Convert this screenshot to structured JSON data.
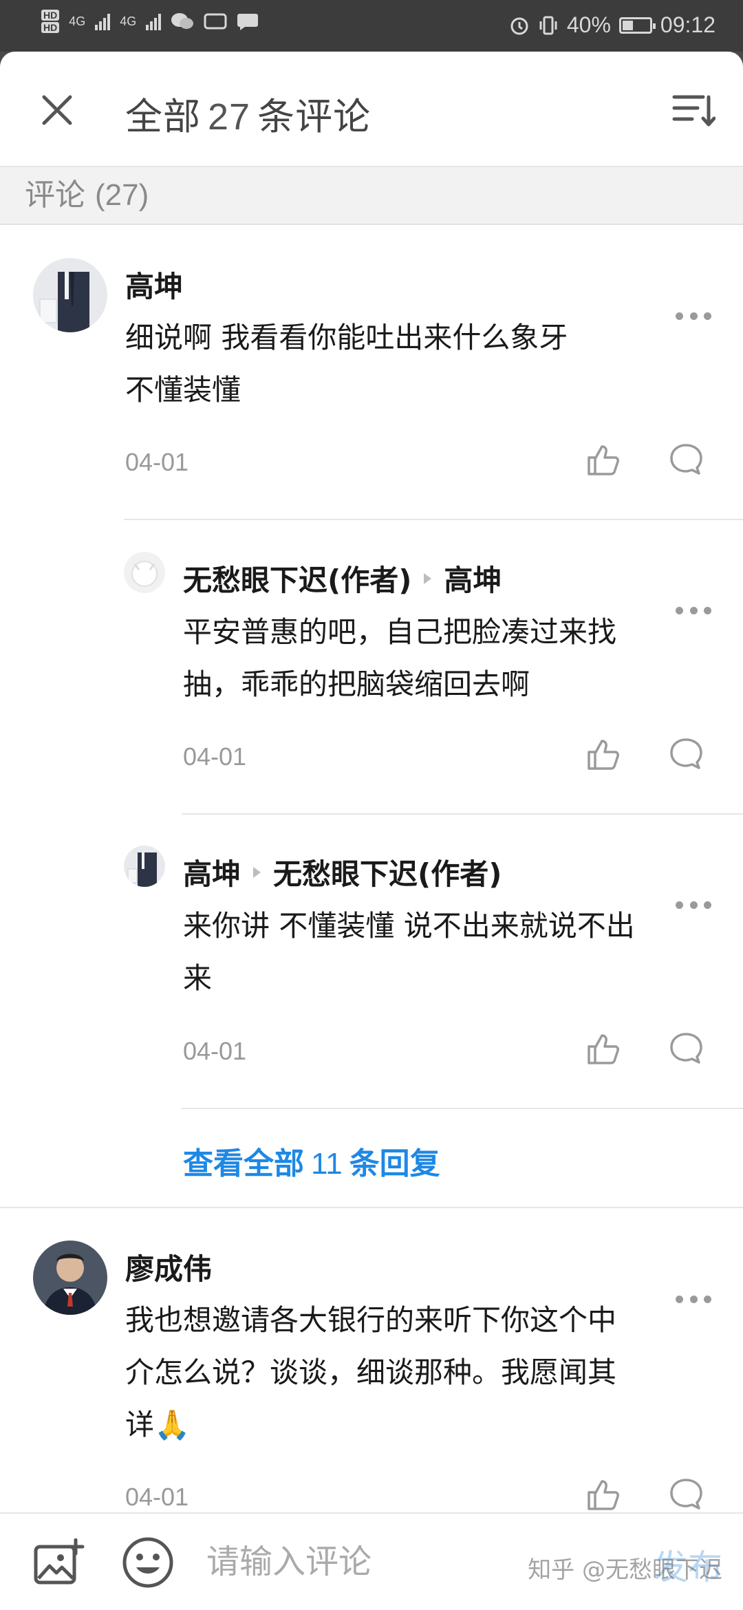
{
  "status_bar": {
    "network": "4G",
    "battery_percent": "40%",
    "time": "09:12",
    "battery_level": 0.4
  },
  "header": {
    "title_prefix": "全部",
    "count": "27",
    "title_suffix": "条评论"
  },
  "section": {
    "label": "评论",
    "count": "(27)"
  },
  "comments": [
    {
      "author": "高坤",
      "text": "细说啊 我看看你能吐出来什么象牙\n不懂装懂",
      "date": "04-01",
      "replies": [
        {
          "author": "无愁眼下迟(作者)",
          "reply_to": "高坤",
          "text": "平安普惠的吧，自己把脸凑过来找\n抽，乖乖的把脑袋缩回去啊",
          "date": "04-01"
        },
        {
          "author": "高坤",
          "reply_to": "无愁眼下迟(作者)",
          "text": "来你讲 不懂装懂 说不出来就说不出\n来",
          "date": "04-01"
        }
      ],
      "view_all": {
        "prefix": "查看全部",
        "count": "11",
        "suffix": "条回复"
      }
    },
    {
      "author": "廖成伟",
      "text": "我也想邀请各大银行的来听下你这个中\n介怎么说？谈谈，细谈那种。我愿闻其\n详🙏",
      "date": "04-01"
    }
  ],
  "bottom_bar": {
    "placeholder": "请输入评论",
    "publish": "发布",
    "watermark": "知乎 @无愁眼下迟"
  }
}
